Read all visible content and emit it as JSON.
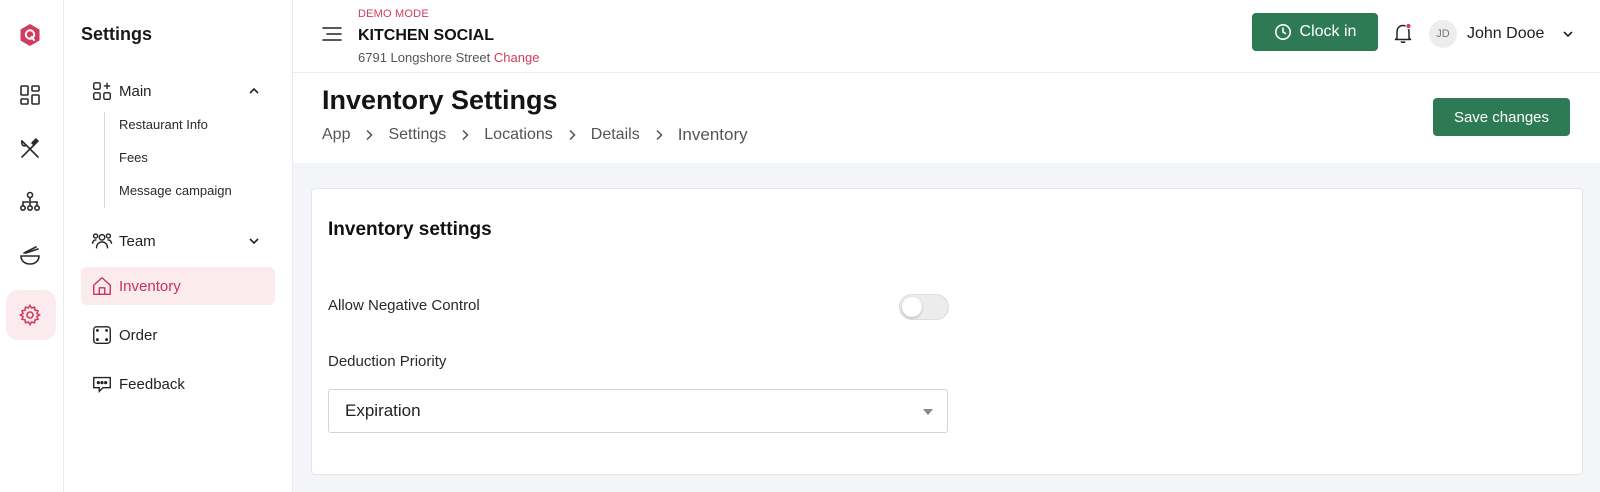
{
  "rail": {
    "icons": [
      "logo-icon",
      "dashboard-icon",
      "utensils-icon",
      "hierarchy-icon",
      "food-bowl-icon",
      "gear-icon"
    ]
  },
  "subnav": {
    "title": "Settings",
    "main_label": "Main",
    "main_children": [
      "Restaurant Info",
      "Fees",
      "Message campaign"
    ],
    "team_label": "Team",
    "inventory_label": "Inventory",
    "order_label": "Order",
    "feedback_label": "Feedback"
  },
  "topbar": {
    "demo_label": "DEMO MODE",
    "business_name": "KITCHEN SOCIAL",
    "address": "6791 Longshore Street",
    "change_label": "Change",
    "clock_in_label": "Clock in",
    "avatar_initials": "JD",
    "user_name": "John Dooe"
  },
  "header": {
    "title": "Inventory Settings",
    "breadcrumbs": [
      "App",
      "Settings",
      "Locations",
      "Details",
      "Inventory"
    ],
    "save_label": "Save changes"
  },
  "card": {
    "title": "Inventory settings",
    "negative_control_label": "Allow Negative Control",
    "negative_control_enabled": false,
    "deduction_label": "Deduction Priority",
    "deduction_value": "Expiration"
  },
  "colors": {
    "accent": "#d23a5e",
    "primary_button": "#2d7a55",
    "active_bg": "#fcebee"
  }
}
